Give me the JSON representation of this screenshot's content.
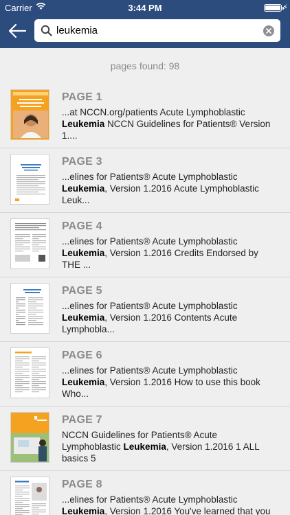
{
  "status_bar": {
    "carrier": "Carrier",
    "time": "3:44 PM"
  },
  "search": {
    "value": "leukemia"
  },
  "results_info": "pages found: 98",
  "colors": {
    "header": "#2d4c7e",
    "background": "#efefef",
    "label": "#8a8a8a",
    "nccn_orange": "#f4a21f"
  },
  "results": [
    {
      "page": "PAGE 1",
      "pre": "...at NCCN.org/patients Acute Lymphoblastic ",
      "bold": "Leukemia",
      "post": " NCCN Guidelines for Patients® Version 1....",
      "thumb": "cover"
    },
    {
      "page": "PAGE 3",
      "pre": "...elines for Patients® Acute Lymphoblastic ",
      "bold": "Leukemia",
      "post": ", Version 1.2016 Acute Lymphoblastic Leuk...",
      "thumb": "text-title"
    },
    {
      "page": "PAGE 4",
      "pre": "...elines for Patients® Acute Lymphoblastic ",
      "bold": "Leukemia",
      "post": ", Version 1.2016 Credits Endorsed by THE ...",
      "thumb": "credits"
    },
    {
      "page": "PAGE 5",
      "pre": "...elines for Patients® Acute Lymphoblastic ",
      "bold": "Leukemia",
      "post": ", Version 1.2016 Contents Acute Lymphobla...",
      "thumb": "contents"
    },
    {
      "page": "PAGE 6",
      "pre": "...elines for Patients® Acute Lymphoblastic ",
      "bold": "Leukemia",
      "post": ", Version 1.2016 How to use this book Who...",
      "thumb": "text-cols"
    },
    {
      "page": "PAGE 7",
      "pre": "NCCN Guidelines for Patients® Acute Lymphoblastic ",
      "bold": "Leukemia",
      "post": ", Version 1.2016 1 ALL basics 5",
      "thumb": "photo"
    },
    {
      "page": "PAGE 8",
      "pre": "...elines for Patients® Acute Lymphoblastic ",
      "bold": "Leukemia",
      "post": ", Version 1.2016 You've learned that you",
      "thumb": "text-photo"
    }
  ]
}
